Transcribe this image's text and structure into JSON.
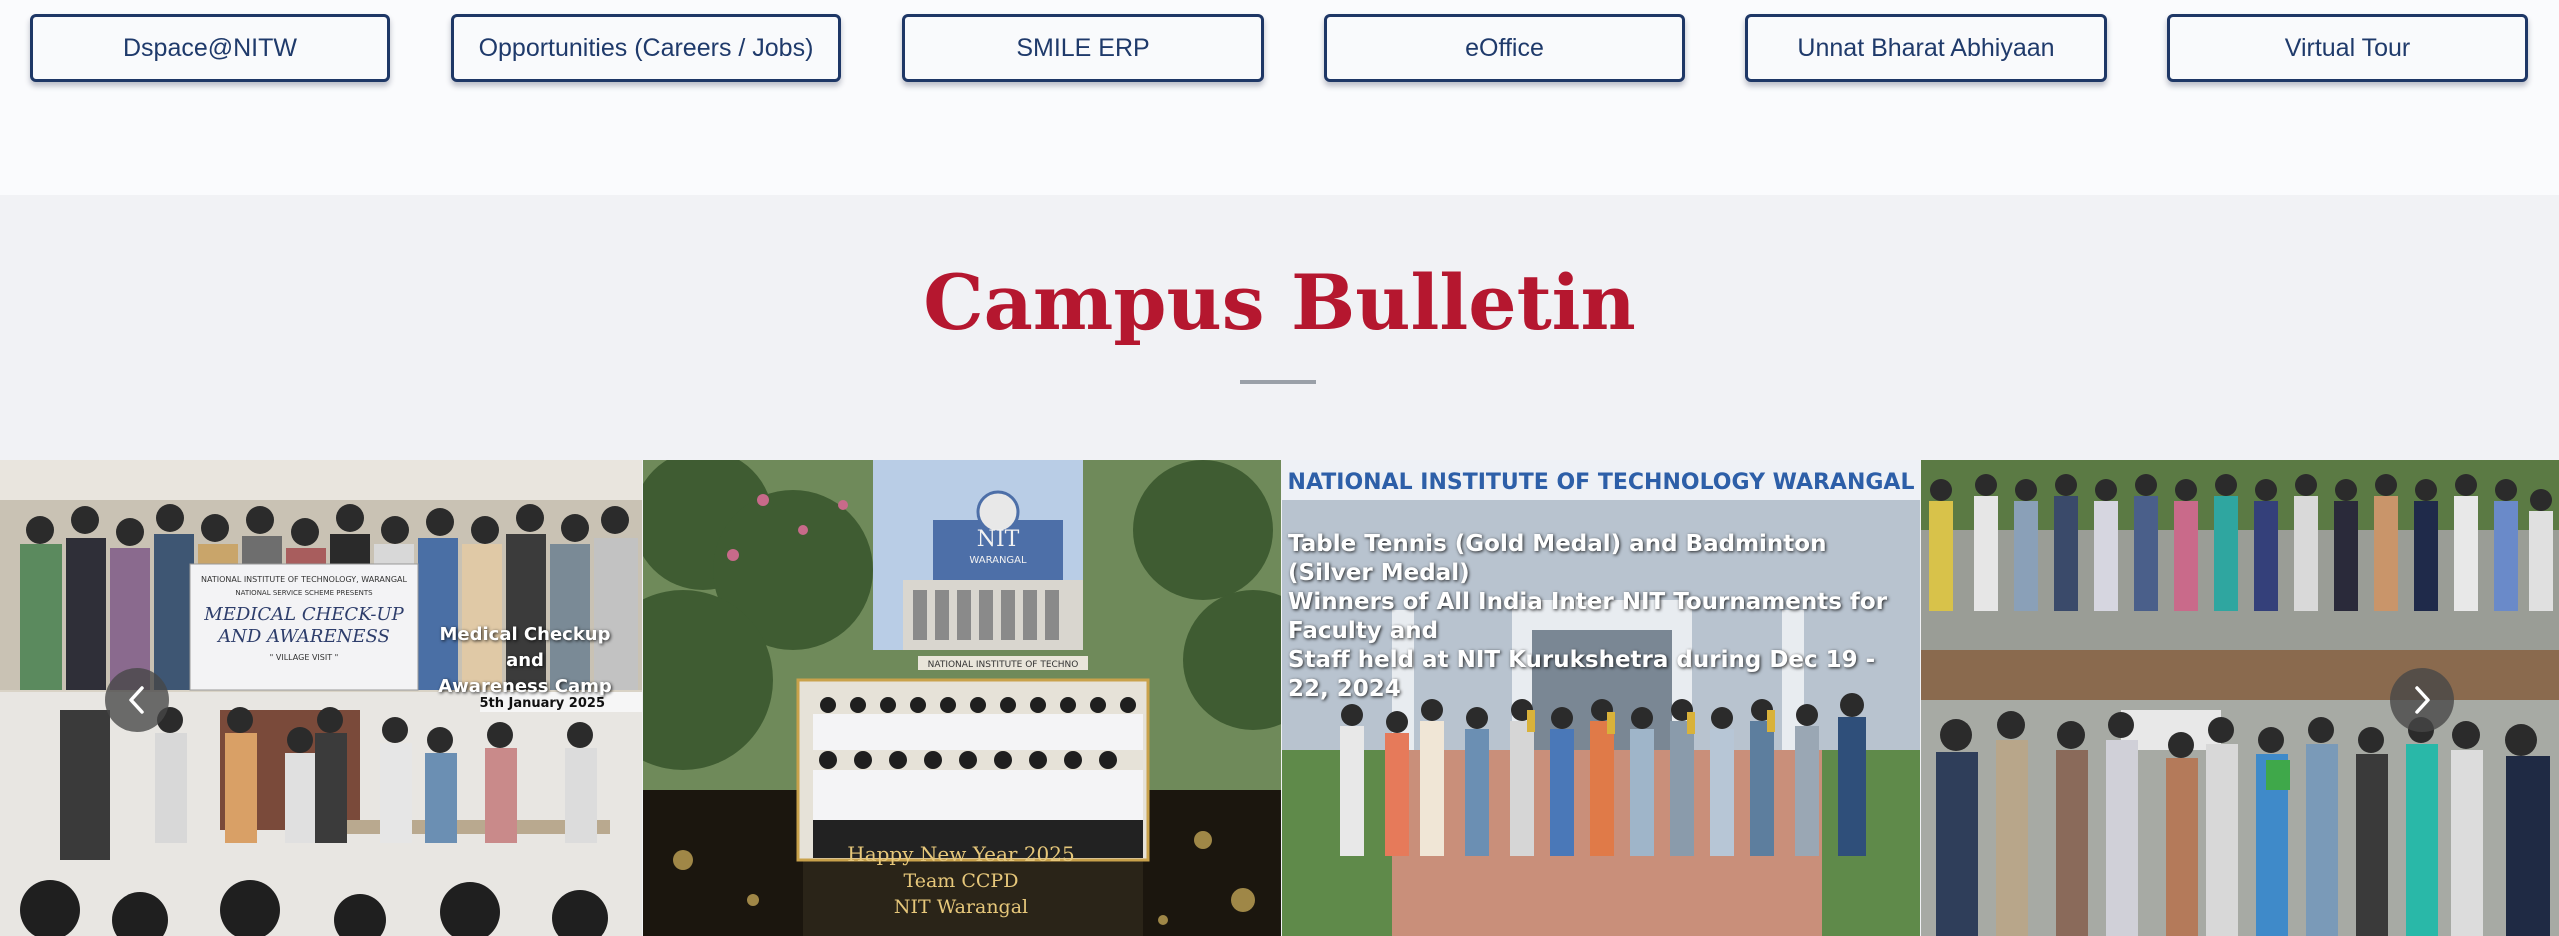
{
  "quick_links": [
    {
      "label": "Dspace@NITW"
    },
    {
      "label": "Opportunities (Careers / Jobs)"
    },
    {
      "label": "SMILE ERP"
    },
    {
      "label": "eOffice"
    },
    {
      "label": "Unnat Bharat Abhiyaan"
    },
    {
      "label": "Virtual Tour"
    }
  ],
  "bulletin": {
    "title": "Campus Bulletin",
    "cards": [
      {
        "banner_org": "NATIONAL INSTITUTE OF TECHNOLOGY, WARANGAL",
        "banner_sub": "NATIONAL SERVICE SCHEME PRESENTS",
        "banner_title1": "MEDICAL CHECK-UP",
        "banner_title2": "AND AWARENESS",
        "banner_note": "\" VILLAGE VISIT \"",
        "caption_line1": "Medical Checkup and",
        "caption_line2": "Awareness Camp",
        "date": "5th January 2025"
      },
      {
        "sign_line1": "NIT",
        "sign_line2": "WARANGAL",
        "sign_strip": "NATIONAL INSTITUTE OF TECHNO",
        "greeting1": "Happy New Year 2025",
        "greeting2": "Team CCPD",
        "greeting3": "NIT Warangal"
      },
      {
        "header": "NATIONAL INSTITUTE OF TECHNOLOGY WARANGAL",
        "caption_line1": "Table Tennis (Gold Medal) and Badminton (Silver Medal)",
        "caption_line2": "Winners of All India Inter NIT Tournaments for Faculty and",
        "caption_line3": "Staff held at NIT Kurukshetra during Dec 19 - 22, 2024"
      },
      {}
    ]
  },
  "icons": {
    "prev": "chevron-left-icon",
    "next": "chevron-right-icon"
  },
  "colors": {
    "title": "#b5172f",
    "button_border": "#1e3766",
    "button_text": "#1f3a6b"
  }
}
